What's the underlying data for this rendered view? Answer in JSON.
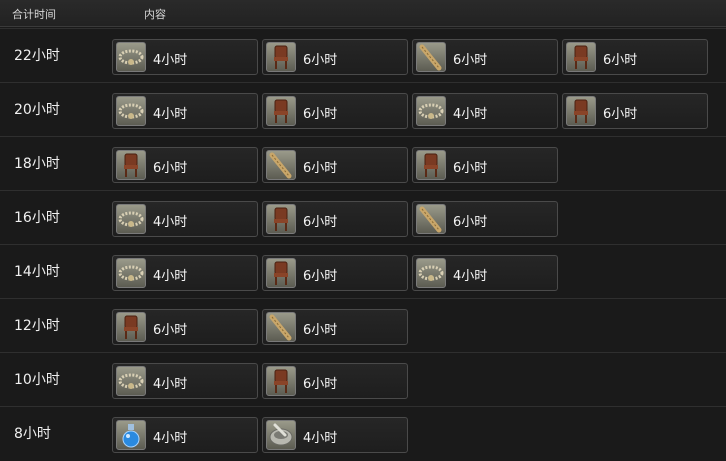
{
  "header": {
    "total_time": "合计时间",
    "content": "内容"
  },
  "rows": [
    {
      "total": "22小时",
      "items": [
        {
          "icon": "bracelet-icon",
          "label": "4小时"
        },
        {
          "icon": "chair-icon",
          "label": "6小时"
        },
        {
          "icon": "club-icon",
          "label": "6小时"
        },
        {
          "icon": "chair-icon",
          "label": "6小时"
        }
      ]
    },
    {
      "total": "20小时",
      "items": [
        {
          "icon": "bracelet-icon",
          "label": "4小时"
        },
        {
          "icon": "chair-icon",
          "label": "6小时"
        },
        {
          "icon": "bracelet-icon",
          "label": "4小时"
        },
        {
          "icon": "chair-icon",
          "label": "6小时"
        }
      ]
    },
    {
      "total": "18小时",
      "items": [
        {
          "icon": "chair-icon",
          "label": "6小时"
        },
        {
          "icon": "club-icon",
          "label": "6小时"
        },
        {
          "icon": "chair-icon",
          "label": "6小时"
        }
      ]
    },
    {
      "total": "16小时",
      "items": [
        {
          "icon": "bracelet-icon",
          "label": "4小时"
        },
        {
          "icon": "chair-icon",
          "label": "6小时"
        },
        {
          "icon": "club-icon",
          "label": "6小时"
        }
      ]
    },
    {
      "total": "14小时",
      "items": [
        {
          "icon": "bracelet-icon",
          "label": "4小时"
        },
        {
          "icon": "chair-icon",
          "label": "6小时"
        },
        {
          "icon": "bracelet-icon",
          "label": "4小时"
        }
      ]
    },
    {
      "total": "12小时",
      "items": [
        {
          "icon": "chair-icon",
          "label": "6小时"
        },
        {
          "icon": "club-icon",
          "label": "6小时"
        }
      ]
    },
    {
      "total": "10小时",
      "items": [
        {
          "icon": "bracelet-icon",
          "label": "4小时"
        },
        {
          "icon": "chair-icon",
          "label": "6小时"
        }
      ]
    },
    {
      "total": "8小时",
      "items": [
        {
          "icon": "potion-icon",
          "label": "4小时"
        },
        {
          "icon": "mortar-icon",
          "label": "4小时"
        }
      ]
    }
  ],
  "colors": {
    "background": "#1a1a1a",
    "cell_border": "#4a4a4a",
    "text": "#f4f4f4"
  }
}
